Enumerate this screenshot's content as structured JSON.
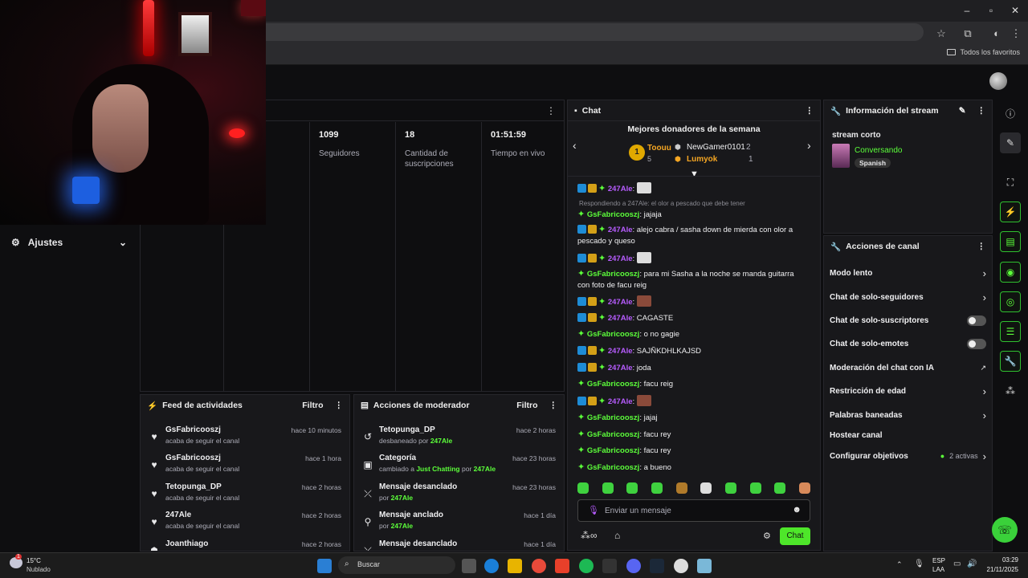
{
  "browser": {
    "bookmarks_folder": "Todos los favoritos",
    "window_controls": [
      "minimize-icon",
      "maximize-icon",
      "close-icon"
    ]
  },
  "nav": {
    "ajustes": "Ajustes"
  },
  "stats": [
    {
      "value": "",
      "label": "ores"
    },
    {
      "value": "1099",
      "label": "Seguidores"
    },
    {
      "value": "18",
      "label": "Cantidad de suscripciones"
    },
    {
      "value": "01:51:59",
      "label": "Tiempo en vivo"
    }
  ],
  "activity_feed": {
    "title": "Feed de actividades",
    "filter": "Filtro",
    "items": [
      {
        "name": "GsFabricooszj",
        "action": "acaba de seguir el canal",
        "time": "hace 10 minutos"
      },
      {
        "name": "GsFabricooszj",
        "action": "acaba de seguir el canal",
        "time": "hace 1 hora"
      },
      {
        "name": "Tetopunga_DP",
        "action": "acaba de seguir el canal",
        "time": "hace 2 horas"
      },
      {
        "name": "247Ale",
        "action": "acaba de seguir el canal",
        "time": "hace 2 horas"
      },
      {
        "name": "Joanthiago",
        "action": "",
        "time": "hace 2 horas"
      }
    ]
  },
  "mod_actions": {
    "title": "Acciones de moderador",
    "filter": "Filtro",
    "items": [
      {
        "name": "Tetopunga_DP",
        "pre": "desbaneado por ",
        "hl": "247Ale",
        "mid": "",
        "hl2": "",
        "time": "hace 2 horas"
      },
      {
        "name": "Categoría",
        "pre": "cambiado a ",
        "hl": "Just Chatting",
        "mid": " por ",
        "hl2": "247Ale",
        "time": "hace 23 horas"
      },
      {
        "name": "Mensaje desanclado",
        "pre": "por ",
        "hl": "247Ale",
        "mid": "",
        "hl2": "",
        "time": "hace 23 horas"
      },
      {
        "name": "Mensaje anclado",
        "pre": "por ",
        "hl": "247Ale",
        "mid": "",
        "hl2": "",
        "time": "hace 1 día"
      },
      {
        "name": "Mensaje desanclado",
        "pre": "",
        "hl": "",
        "mid": "",
        "hl2": "",
        "time": "hace 1 día"
      }
    ]
  },
  "chat": {
    "title": "Chat",
    "donors_title": "Mejores donadores de la semana",
    "donor1_name": "Toouu",
    "donor1_count": "5",
    "donor1_rank": "1",
    "donor2_name": "NewGamer0101",
    "donor2_count": "2",
    "donor3_name": "Lumyok",
    "donor3_count": "1",
    "reply_note": "Respondiendo a 247Ale: el olor a pescado que debe tener",
    "messages": [
      {
        "user": "247Ale",
        "text": ""
      },
      {
        "user": "GsFabricooszj",
        "text": "jajaja"
      },
      {
        "user": "247Ale",
        "text": "alejo cabra / sasha down de mierda con olor a pescado y queso"
      },
      {
        "user": "247Ale",
        "text": ""
      },
      {
        "user": "GsFabricooszj",
        "text": "para mi Sasha a la noche se manda guitarra con foto de facu reig"
      },
      {
        "user": "247Ale",
        "text": ""
      },
      {
        "user": "247Ale",
        "text": "CAGASTE"
      },
      {
        "user": "GsFabricooszj",
        "text": "o no gagie"
      },
      {
        "user": "247Ale",
        "text": "SAJÑKDHLKAJSD"
      },
      {
        "user": "247Ale",
        "text": "joda"
      },
      {
        "user": "GsFabricooszj",
        "text": "facu reig"
      },
      {
        "user": "247Ale",
        "text": ""
      },
      {
        "user": "GsFabricooszj",
        "text": "jajaj"
      },
      {
        "user": "GsFabricooszj",
        "text": "facu rey"
      },
      {
        "user": "GsFabricooszj",
        "text": "facu rey"
      },
      {
        "user": "GsFabricooszj",
        "text": "a bueno"
      }
    ],
    "input_placeholder": "Enviar un mensaje",
    "send_label": "Chat"
  },
  "stream_info": {
    "title": "Información del stream",
    "stream_title": "stream corto",
    "category": "Conversando",
    "tag": "Spanish"
  },
  "channel_actions": {
    "title": "Acciones de canal",
    "slow": "Modo lento",
    "followers": "Chat de solo-seguidores",
    "subs": "Chat de solo-suscriptores",
    "emotes": "Chat de solo-emotes",
    "ai_mod": "Moderación del chat con IA",
    "age": "Restricción de edad",
    "banned": "Palabras baneadas",
    "host": "Hostear canal",
    "goals": "Configurar objetivos",
    "goals_active": "2 activas"
  },
  "taskbar": {
    "weather_temp": "15°C",
    "weather_desc": "Nublado",
    "search": "Buscar",
    "lang1": "ESP",
    "lang2": "LAA",
    "time": "03:29",
    "date": "21/11/2025",
    "notif_badge": "1"
  },
  "colors": {
    "accent": "#53fc18",
    "purple": "#b75cff",
    "panel": "#18181b"
  }
}
